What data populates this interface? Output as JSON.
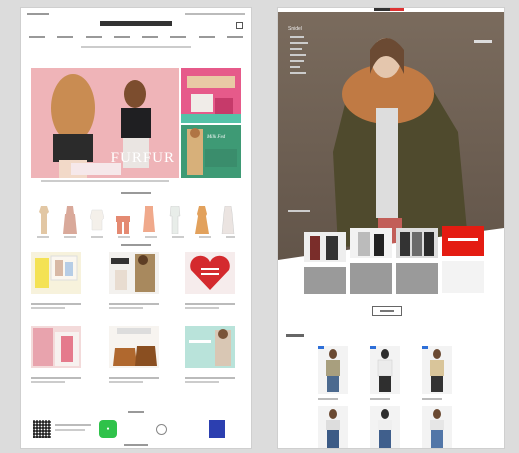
{
  "left": {
    "hero_title": "FURFUR",
    "side_promo_script": "Milk Fed"
  },
  "right": {
    "brand": "Snidel"
  }
}
